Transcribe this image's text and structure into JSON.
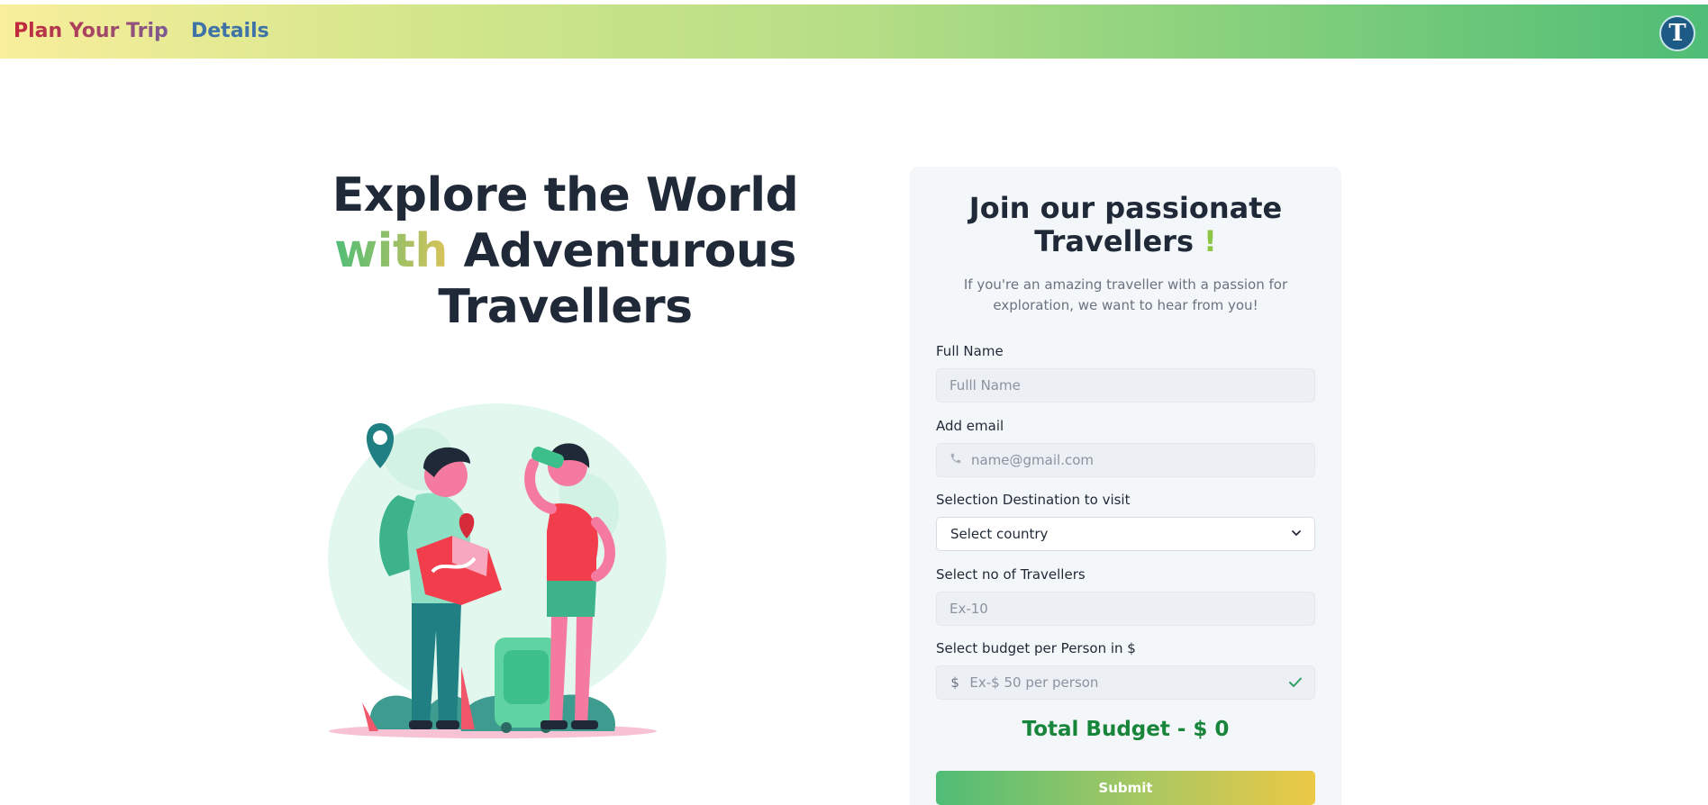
{
  "nav": {
    "brand": "Plan Your Trip",
    "details_link": "Details",
    "avatar_letter": "T"
  },
  "hero": {
    "line1": "Explore the World",
    "line2_accent": "with",
    "line2_rest": " Adventurous",
    "line3": "Travellers"
  },
  "form": {
    "title_line1": "Join our passionate",
    "title_line2": "Travellers ",
    "title_exclaim": "!",
    "subtitle": "If you're an amazing traveller with a passion for exploration, we want to hear from you!",
    "full_name_label": "Full Name",
    "full_name_placeholder": "Fulll Name",
    "email_label": "Add email",
    "email_placeholder": "name@gmail.com",
    "destination_label": "Selection Destination to visit",
    "destination_selected": "Select country",
    "travellers_label": "Select no of Travellers",
    "travellers_placeholder": "Ex-10",
    "budget_label": "Select budget per Person in $",
    "budget_prefix": "$",
    "budget_placeholder": "Ex-$ 50 per person",
    "total_budget": "Total Budget - $ 0",
    "submit_label": "Submit"
  },
  "colors": {
    "nav_gradient_start": "#f8ee9c",
    "nav_gradient_end": "#4fbd76",
    "brand_red": "#c2273a",
    "link_blue": "#3f73a8",
    "total_green": "#17853a",
    "card_bg": "#f4f7f9"
  },
  "icons": {
    "email_prefix": "phone-icon",
    "budget_suffix": "check-icon",
    "select_caret": "chevron-down-icon"
  }
}
